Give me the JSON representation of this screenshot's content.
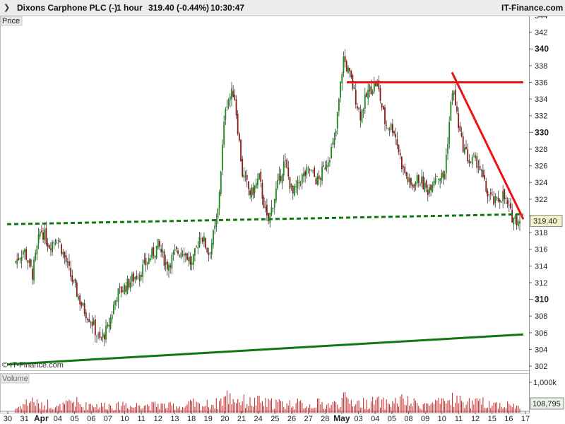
{
  "header": {
    "instrument": "Dixons Carphone PLC (-)",
    "timeframe": "1 hour",
    "last_change": "319.40 (-0.44%)",
    "time": "10:30:47",
    "brand": "IT-Finance.com",
    "collapse_icon": "chevron-icon"
  },
  "labels": {
    "price_panel": "Price",
    "volume_panel": "Volume",
    "watermark": "© IT-Finance.com",
    "last_price_tag": "319.40",
    "last_volume_tag": "108,795",
    "volume_tick": "1,000k"
  },
  "colors": {
    "up_candle": "#1a8a1a",
    "down_candle": "#8b1a1a",
    "resistance": "#ee1111",
    "support": "#117711",
    "volume": "#cc3333",
    "price_tag_bg": "#f3f3cc"
  },
  "chart_data": {
    "type": "candlestick",
    "title": "Dixons Carphone PLC (-)",
    "timeframe": "1 hour",
    "y_range": [
      301.5,
      344.0
    ],
    "y_ticks": [
      302,
      304,
      306,
      308,
      310,
      312,
      314,
      316,
      318,
      320,
      322,
      324,
      326,
      328,
      330,
      332,
      334,
      336,
      338,
      340,
      342,
      344
    ],
    "y_major_ticks": [
      310,
      320,
      330,
      340
    ],
    "y_hidden_tick": 320,
    "x_tick_labels": [
      "30",
      "31",
      "Apr",
      "04",
      "05",
      "06",
      "07",
      "10",
      "11",
      "12",
      "13",
      "18",
      "19",
      "20",
      "21",
      "24",
      "25",
      "26",
      "27",
      "28",
      "May",
      "03",
      "04",
      "05",
      "08",
      "09",
      "10",
      "11",
      "12",
      "15",
      "16",
      "17"
    ],
    "x_bold_labels": [
      "Apr",
      "May"
    ],
    "last_price": 319.4,
    "price_path": [
      [
        0,
        314.5
      ],
      [
        1,
        316.0
      ],
      [
        2,
        313.0
      ],
      [
        3,
        318.5
      ],
      [
        4,
        316.5
      ],
      [
        5,
        317.5
      ],
      [
        6,
        314.5
      ],
      [
        7,
        311.5
      ],
      [
        8,
        309.0
      ],
      [
        9,
        307.5
      ],
      [
        10,
        305.0
      ],
      [
        11,
        306.5
      ],
      [
        12,
        310.5
      ],
      [
        13,
        311.5
      ],
      [
        14,
        312.5
      ],
      [
        15,
        313.5
      ],
      [
        16,
        315.0
      ],
      [
        17,
        316.5
      ],
      [
        18,
        314.0
      ],
      [
        19,
        315.5
      ],
      [
        20,
        316.0
      ],
      [
        21,
        314.0
      ],
      [
        22,
        318.0
      ],
      [
        23,
        315.5
      ],
      [
        24,
        319.5
      ],
      [
        25,
        333.5
      ],
      [
        26,
        335.0
      ],
      [
        27,
        325.0
      ],
      [
        28,
        322.5
      ],
      [
        29,
        324.5
      ],
      [
        30,
        319.0
      ],
      [
        31,
        323.0
      ],
      [
        32,
        326.5
      ],
      [
        33,
        322.5
      ],
      [
        34,
        324.5
      ],
      [
        35,
        325.5
      ],
      [
        36,
        324.0
      ],
      [
        37,
        326.5
      ],
      [
        38,
        329.0
      ],
      [
        39,
        339.0
      ],
      [
        40,
        336.0
      ],
      [
        41,
        332.0
      ],
      [
        42,
        335.0
      ],
      [
        43,
        336.0
      ],
      [
        44,
        331.0
      ],
      [
        45,
        330.5
      ],
      [
        46,
        326.0
      ],
      [
        47,
        323.5
      ],
      [
        48,
        324.5
      ],
      [
        49,
        323.0
      ],
      [
        50,
        325.0
      ],
      [
        51,
        324.5
      ],
      [
        52,
        335.5
      ],
      [
        53,
        329.0
      ],
      [
        54,
        326.5
      ],
      [
        55,
        326.5
      ],
      [
        56,
        323.0
      ],
      [
        57,
        321.5
      ],
      [
        58,
        322.5
      ],
      [
        59,
        320.0
      ],
      [
        60,
        319.4
      ]
    ],
    "volume_path": [
      [
        0,
        140
      ],
      [
        1,
        280
      ],
      [
        2,
        420
      ],
      [
        3,
        200
      ],
      [
        4,
        310
      ],
      [
        5,
        160
      ],
      [
        6,
        250
      ],
      [
        7,
        380
      ],
      [
        8,
        180
      ],
      [
        9,
        300
      ],
      [
        10,
        220
      ],
      [
        11,
        260
      ],
      [
        12,
        190
      ],
      [
        13,
        320
      ],
      [
        14,
        170
      ],
      [
        15,
        350
      ],
      [
        16,
        210
      ],
      [
        17,
        270
      ],
      [
        18,
        200
      ],
      [
        19,
        240
      ],
      [
        20,
        180
      ],
      [
        21,
        300
      ],
      [
        22,
        220
      ],
      [
        23,
        280
      ],
      [
        24,
        300
      ],
      [
        25,
        520
      ],
      [
        26,
        460
      ],
      [
        27,
        380
      ],
      [
        28,
        330
      ],
      [
        29,
        360
      ],
      [
        30,
        290
      ],
      [
        31,
        330
      ],
      [
        32,
        260
      ],
      [
        33,
        310
      ],
      [
        34,
        270
      ],
      [
        35,
        240
      ],
      [
        36,
        300
      ],
      [
        37,
        250
      ],
      [
        38,
        280
      ],
      [
        39,
        430
      ],
      [
        40,
        380
      ],
      [
        41,
        300
      ],
      [
        42,
        320
      ],
      [
        43,
        350
      ],
      [
        44,
        290
      ],
      [
        45,
        330
      ],
      [
        46,
        400
      ],
      [
        47,
        300
      ],
      [
        48,
        280
      ],
      [
        49,
        260
      ],
      [
        50,
        310
      ],
      [
        51,
        290
      ],
      [
        52,
        480
      ],
      [
        53,
        350
      ],
      [
        54,
        320
      ],
      [
        55,
        300
      ],
      [
        56,
        340
      ],
      [
        57,
        280
      ],
      [
        58,
        260
      ],
      [
        59,
        250
      ],
      [
        60,
        180
      ]
    ],
    "volume_range": [
      0,
      1300
    ],
    "volume_ticks": [
      1000
    ],
    "trendlines": [
      {
        "name": "resistance-horizontal",
        "color": "red",
        "style": "solid",
        "from": [
          "May 02",
          336.0
        ],
        "to": [
          "May 17",
          336.0
        ]
      },
      {
        "name": "resistance-descending",
        "color": "red",
        "style": "solid",
        "from": [
          "May 10",
          337.2
        ],
        "to": [
          "May 17",
          319.6
        ]
      },
      {
        "name": "support-horizontal",
        "color": "green",
        "style": "dashed",
        "from": [
          "Mar 30",
          319.0
        ],
        "to": [
          "May 17",
          320.2
        ]
      },
      {
        "name": "support-rising",
        "color": "green",
        "style": "solid",
        "from": [
          "Mar 30",
          302.2
        ],
        "to": [
          "May 17",
          305.8
        ]
      }
    ],
    "grid": "off",
    "y_axis_side": "right"
  }
}
